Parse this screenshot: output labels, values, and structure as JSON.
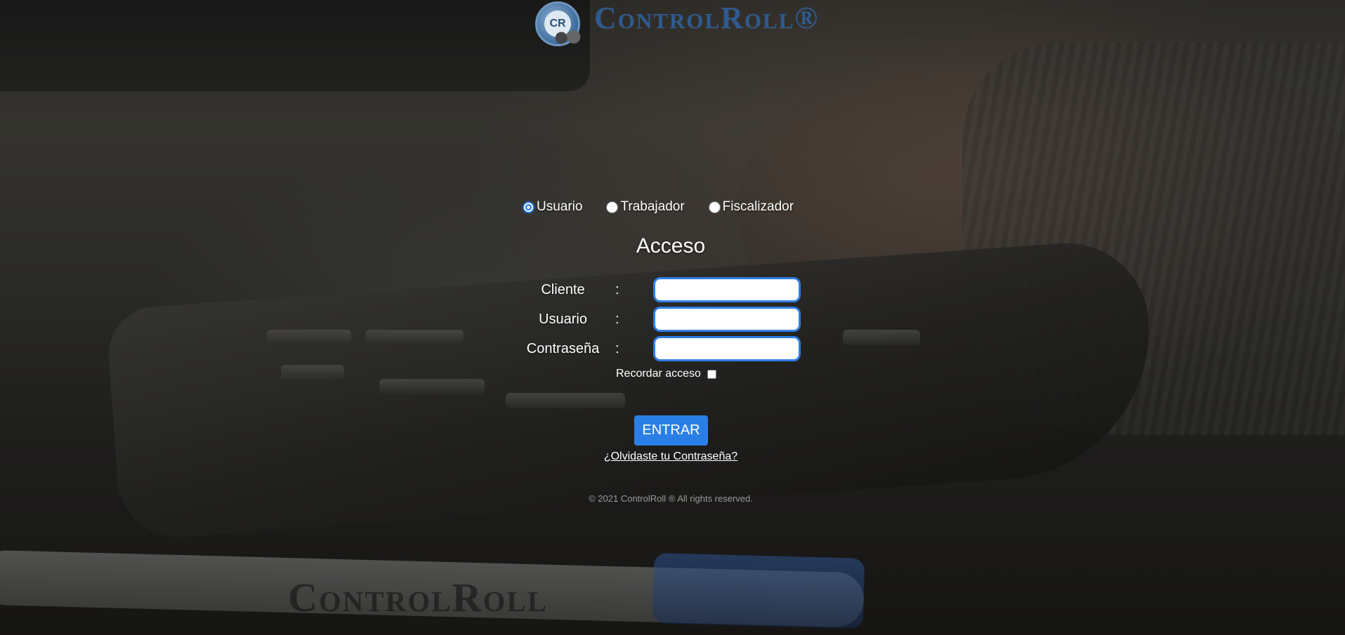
{
  "logo": {
    "text": "ControlRoll®",
    "mark_text": "CR"
  },
  "roles": {
    "selected": "Usuario",
    "options": [
      {
        "label": "Usuario",
        "checked": true
      },
      {
        "label": "Trabajador",
        "checked": false
      },
      {
        "label": "Fiscalizador",
        "checked": false
      }
    ]
  },
  "form": {
    "title": "Acceso",
    "colon": ":",
    "fields": [
      {
        "label": "Cliente",
        "value": ""
      },
      {
        "label": "Usuario",
        "value": ""
      },
      {
        "label": "Contraseña",
        "value": ""
      }
    ],
    "remember_label": "Recordar acceso",
    "remember_checked": false,
    "submit_label": "ENTRAR",
    "forgot_link": "¿Olvidaste tu Contraseña?"
  },
  "footer": {
    "copyright": "© 2021 ControlRoll ® All rights reserved."
  },
  "colors": {
    "accent": "#2a7fe6",
    "logo_text": "#2e5a8f",
    "footer_text": "#9a9a9a"
  },
  "background": {
    "pen_text": "ControlRoll"
  }
}
